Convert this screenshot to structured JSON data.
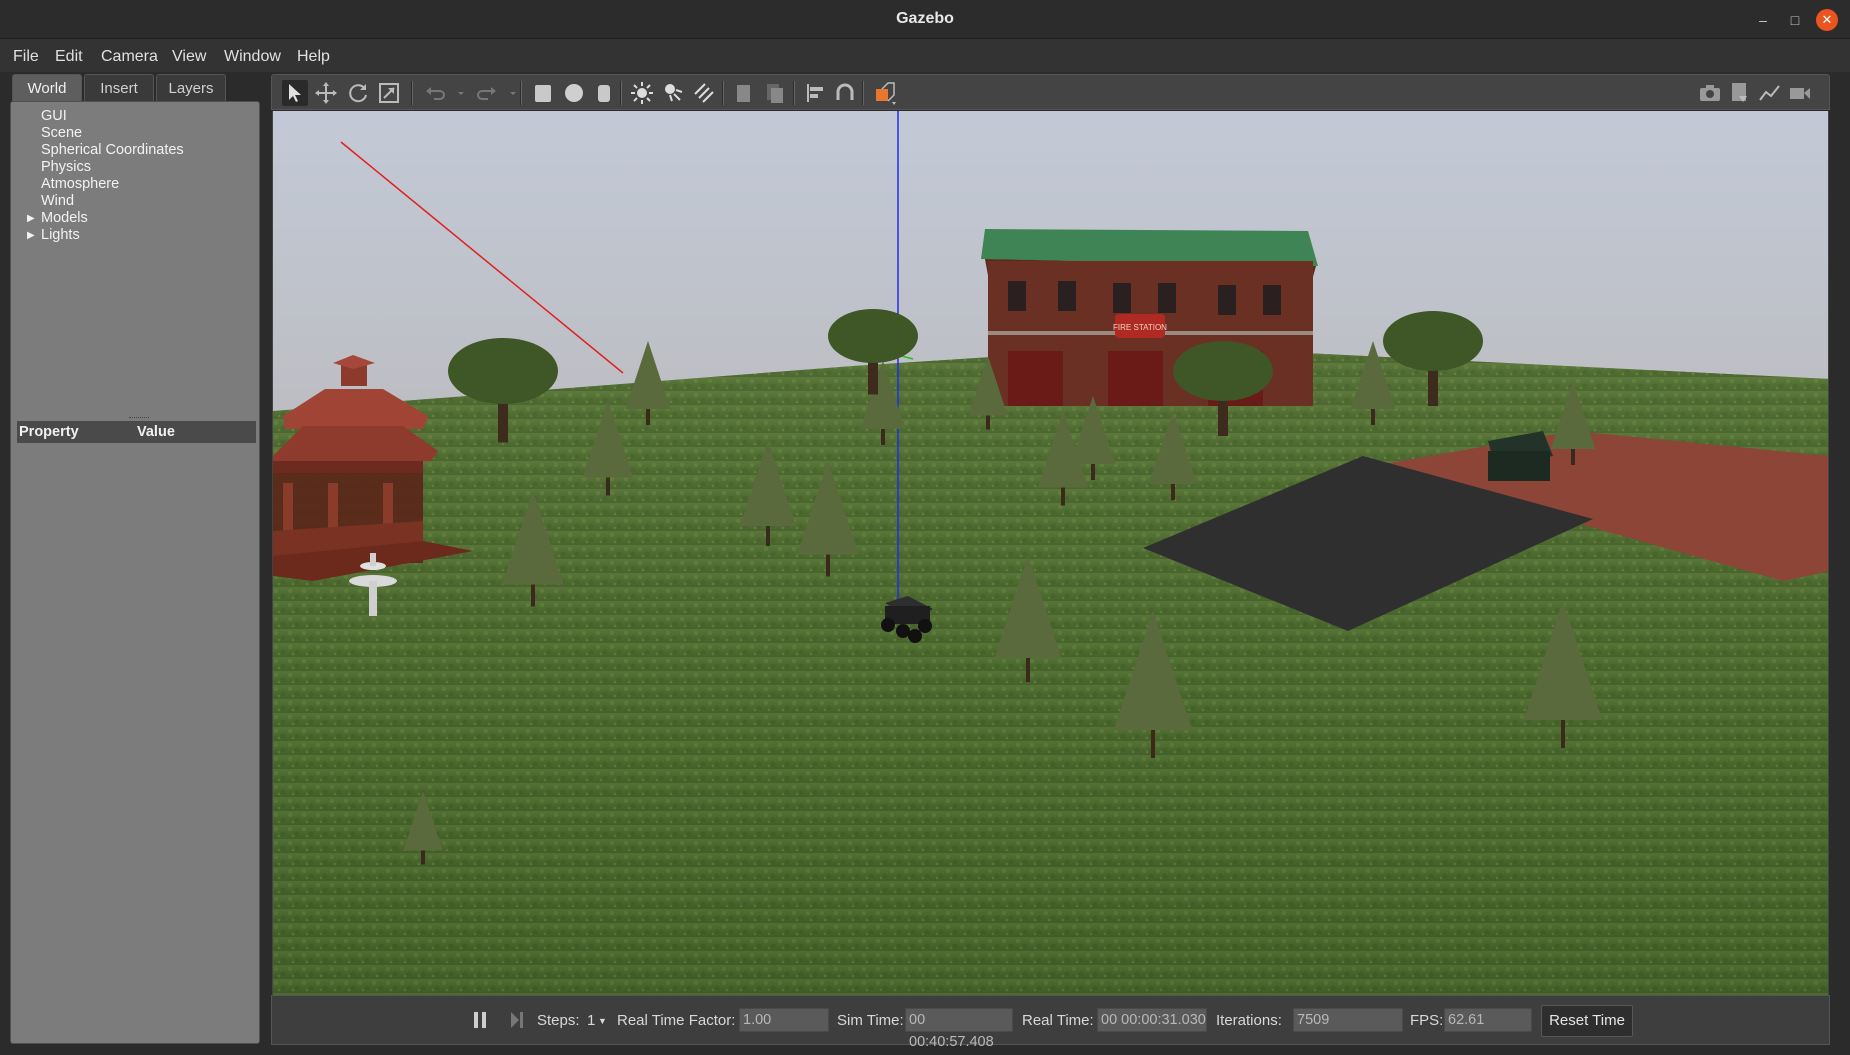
{
  "window": {
    "title": "Gazebo"
  },
  "menu": {
    "file": "File",
    "edit": "Edit",
    "camera": "Camera",
    "view": "View",
    "window": "Window",
    "help": "Help"
  },
  "left_panel": {
    "tabs": [
      {
        "label": "World",
        "active": true
      },
      {
        "label": "Insert",
        "active": false
      },
      {
        "label": "Layers",
        "active": false
      }
    ],
    "tree": [
      {
        "label": "GUI",
        "expandable": false
      },
      {
        "label": "Scene",
        "expandable": false
      },
      {
        "label": "Spherical Coordinates",
        "expandable": false
      },
      {
        "label": "Physics",
        "expandable": false
      },
      {
        "label": "Atmosphere",
        "expandable": false
      },
      {
        "label": "Wind",
        "expandable": false
      },
      {
        "label": "Models",
        "expandable": true
      },
      {
        "label": "Lights",
        "expandable": true
      }
    ],
    "property_header": {
      "property": "Property",
      "value": "Value"
    }
  },
  "toolbar": {
    "left_icons": [
      "select-icon",
      "translate-icon",
      "rotate-icon",
      "scale-icon",
      "undo-icon",
      "redo-icon",
      "box-icon",
      "sphere-icon",
      "cylinder-icon",
      "point-light-icon",
      "spot-light-icon",
      "directional-light-icon",
      "copy-icon",
      "paste-icon",
      "align-icon",
      "snap-icon",
      "view-angle-icon"
    ],
    "right_icons": [
      "screenshot-icon",
      "log-icon",
      "plot-icon",
      "record-icon"
    ],
    "accent_color": "#e8772e"
  },
  "viewport": {
    "building_sign": "FIRE STATION"
  },
  "status": {
    "steps_label": "Steps:",
    "steps_value": "1",
    "rtf_label": "Real Time Factor:",
    "rtf_value": "1.00",
    "sim_time_label": "Sim Time:",
    "sim_time_value": "00 00:40:57.408",
    "real_time_label": "Real Time:",
    "real_time_value": "00 00:00:31.030",
    "iterations_label": "Iterations:",
    "iterations_value": "7509",
    "fps_label": "FPS:",
    "fps_value": "62.61",
    "reset_label": "Reset Time"
  }
}
